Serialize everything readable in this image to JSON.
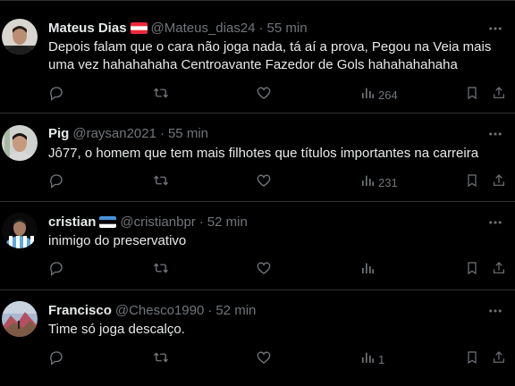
{
  "tweets": [
    {
      "name": "Mateus Dias",
      "handle": "@Mateus_dias24",
      "separator": "·",
      "time": "55 min",
      "text": "Depois falam que o cara não joga nada, tá aí a prova, Pegou na Veia mais uma vez hahahahaha Centroavante Fazedor de Gols hahahahahaha",
      "views": "264",
      "flag": "austria-flag",
      "avatar": "man-portrait-avatar"
    },
    {
      "name": "Pig",
      "handle": "@raysan2021",
      "separator": "·",
      "time": "55 min",
      "text": "Jô77, o homem que tem mais filhotes que títulos importantes na carreira",
      "views": "231",
      "avatar": "man-portrait-avatar"
    },
    {
      "name": "cristian",
      "handle": "@cristianbpr",
      "separator": "·",
      "time": "52 min",
      "text": "inimigo do preservativo",
      "views": "",
      "flag": "estonia-flag",
      "avatar": "striped-jersey-avatar"
    },
    {
      "name": "Francisco",
      "handle": "@Chesco1990",
      "separator": "·",
      "time": "52 min",
      "text": "Time só joga descalço.",
      "views": "1",
      "avatar": "mountain-landscape-avatar"
    }
  ],
  "icons": [
    "more-icon",
    "reply-icon",
    "retweet-icon",
    "like-icon",
    "views-icon",
    "bookmark-icon",
    "share-icon"
  ],
  "colors": {
    "background": "#000000",
    "text": "#e7e9ea",
    "secondary": "#71767b",
    "divider": "#2f3336"
  }
}
